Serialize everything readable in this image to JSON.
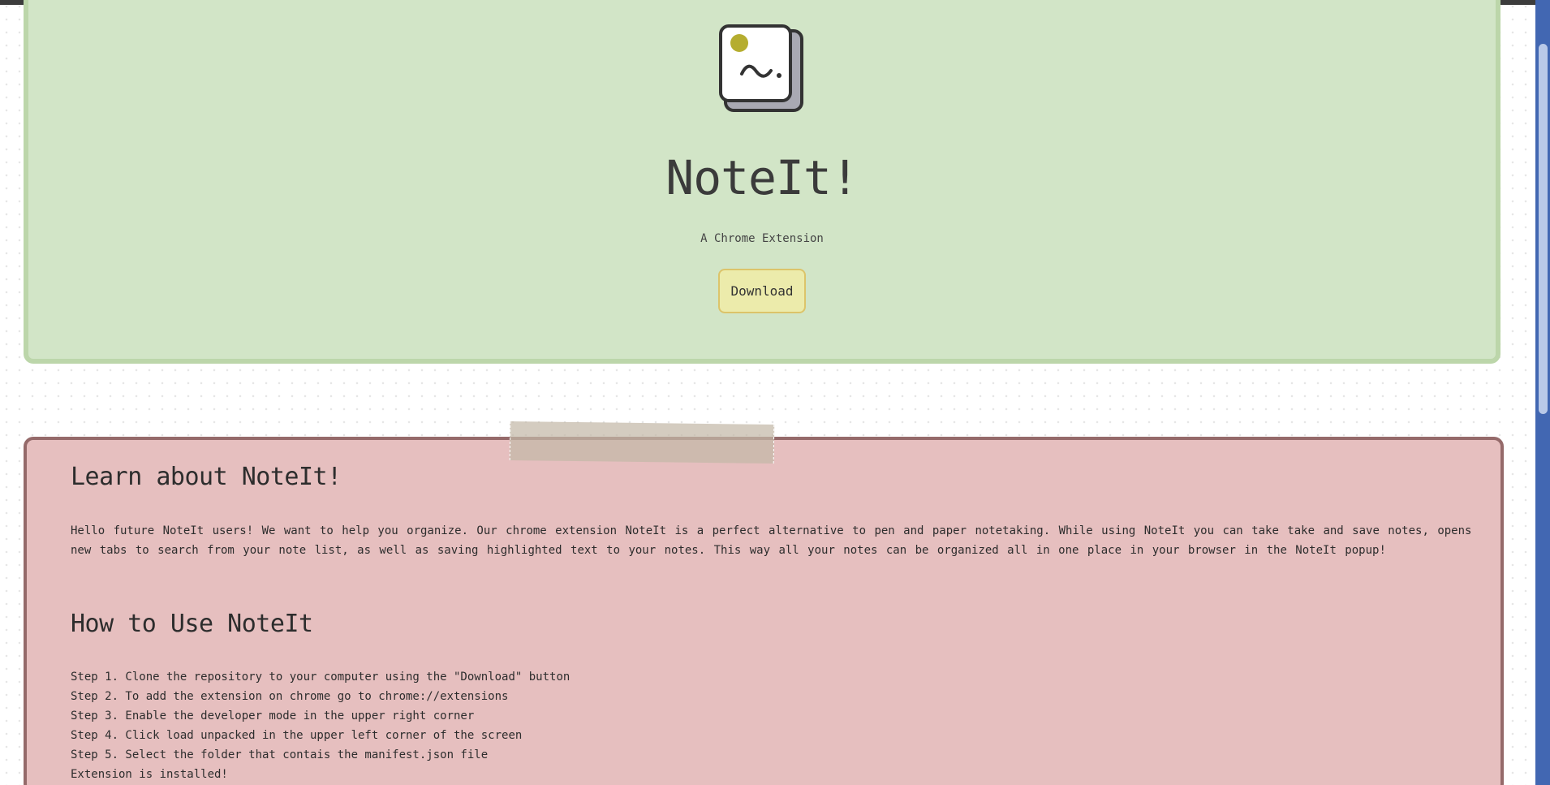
{
  "hero": {
    "logo_icon": "sticky-note-icon",
    "title": "NoteIt!",
    "subtitle": "A Chrome Extension",
    "download_label": "Download"
  },
  "learn": {
    "heading": "Learn about NoteIt!",
    "body": "Hello future NoteIt users! We want to help you organize. Our chrome extension NoteIt is a perfect alternative to pen and paper notetaking. While using NoteIt you can take take and save notes, opens new tabs to search from your note list, as well as saving highlighted text to your notes. This way all your notes can be organized all in one place in your browser in the NoteIt popup!"
  },
  "howto": {
    "heading": "How to Use NoteIt",
    "steps": [
      "Step 1. Clone the repository to your computer using the \"Download\" button",
      "Step 2. To add the extension on chrome go to chrome://extensions",
      "Step 3. Enable the developer mode in the upper right corner",
      "Step 4. Click load unpacked in the upper left corner of the screen",
      "Step 5. Select the folder that contais the manifest.json file",
      "Extension is installed!"
    ]
  },
  "colors": {
    "hero_bg": "#d2e5c7",
    "hero_border": "#bcd6aa",
    "learn_bg": "#e6bfbf",
    "learn_border": "#956a6a",
    "button_bg": "#ecebab",
    "button_border": "#dcc46a",
    "scrollbar": "#4267b2"
  }
}
